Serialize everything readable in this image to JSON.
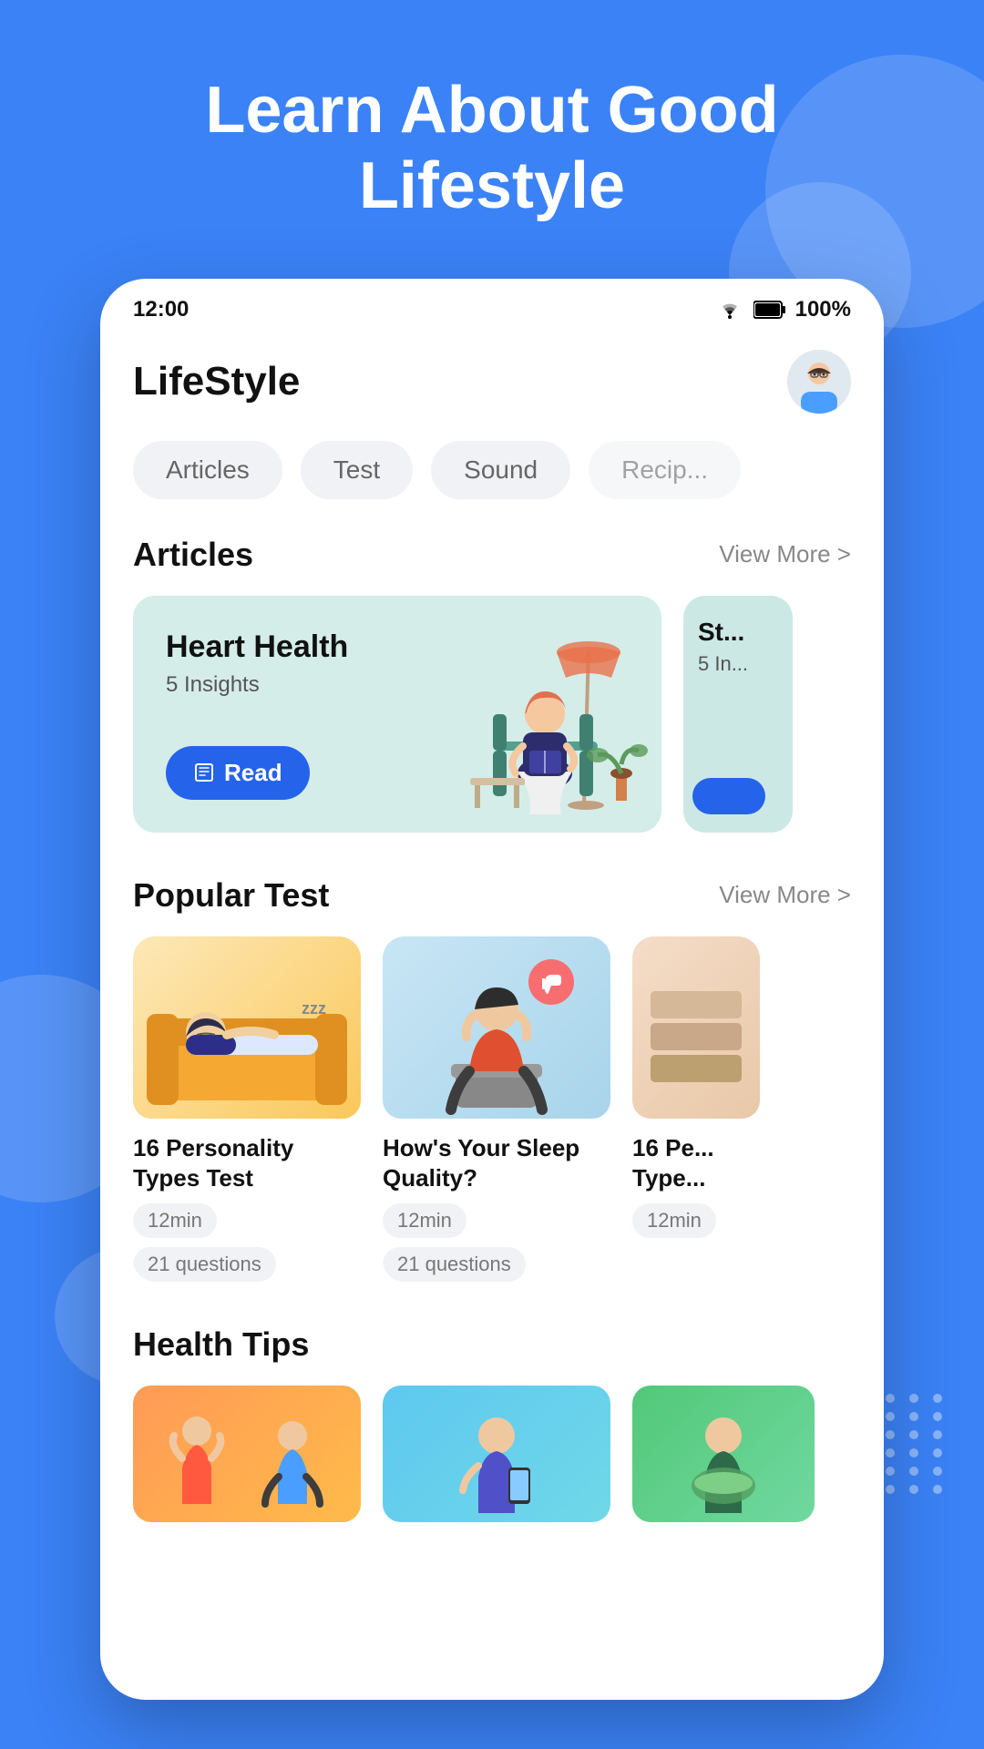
{
  "header": {
    "title": "Learn About Good Lifestyle"
  },
  "status_bar": {
    "time": "12:00",
    "battery": "100%",
    "wifi": "wifi",
    "battery_icon": "battery"
  },
  "app": {
    "title": "LifeStyle",
    "avatar_label": "user avatar"
  },
  "categories": [
    {
      "label": "Articles",
      "id": "articles"
    },
    {
      "label": "Test",
      "id": "test"
    },
    {
      "label": "Sound",
      "id": "sound"
    },
    {
      "label": "Recip...",
      "id": "recipe"
    }
  ],
  "articles_section": {
    "title": "Articles",
    "view_more": "View More >"
  },
  "article_cards": [
    {
      "title": "Heart Health",
      "subtitle": "5 Insights",
      "read_label": "Read",
      "color": "#d4ede9"
    },
    {
      "title": "St...",
      "subtitle": "5 In...",
      "color": "#d4ede9"
    }
  ],
  "popular_test_section": {
    "title": "Popular Test",
    "view_more": "View More >"
  },
  "test_cards": [
    {
      "title": "16 Personality Types Test",
      "time": "12min",
      "questions": "21 questions",
      "color": "#fde8b8"
    },
    {
      "title": "How's Your Sleep Quality?",
      "time": "12min",
      "questions": "21 questions",
      "color": "#c8e6f5"
    },
    {
      "title": "16 Pe... Type...",
      "time": "12min",
      "questions": "",
      "color": "#f5ddc8"
    }
  ],
  "health_tips": {
    "title": "Health Tips"
  }
}
